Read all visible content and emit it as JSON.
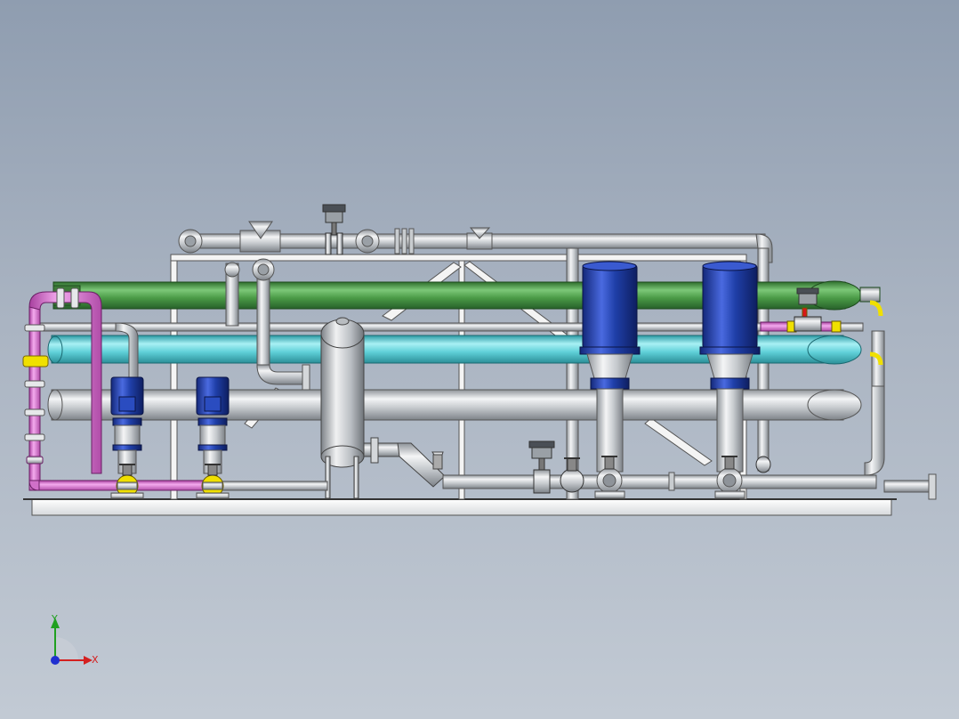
{
  "view": {
    "type": "3d-cad-model-view",
    "background_top": "#8f9db0",
    "background_bottom": "#c2cad4"
  },
  "colors": {
    "steel": "#c4c8cc",
    "steel_dark": "#8b9096",
    "steel_light": "#eceef0",
    "green_header": "#4a9a46",
    "cyan_header": "#5fd0d8",
    "pink_line": "#e07ad8",
    "motor_blue": "#1f3fa8",
    "yellow": "#f0e000",
    "red": "#d81818",
    "frame": "#f2f2f2"
  },
  "components": {
    "membrane_vessels": 3,
    "vertical_pumps_small": 2,
    "vertical_pumps_large": 2,
    "tank": 1
  },
  "triad": {
    "x_label": "X",
    "y_label": "Y",
    "x_color": "#d42020",
    "y_color": "#20a020",
    "z_color": "#2030d0"
  }
}
